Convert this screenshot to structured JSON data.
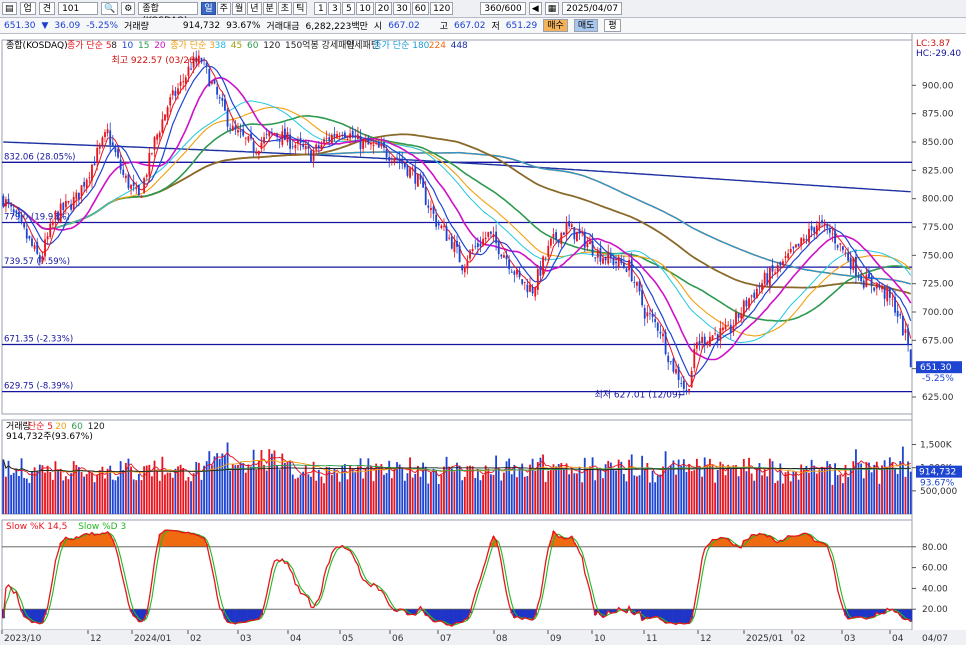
{
  "toolbar": {
    "up_label": "업",
    "period_label": "견",
    "code_value": "101",
    "name_value": "종합(KOSDAQ)",
    "tabs": [
      "일",
      "주",
      "월",
      "년",
      "분",
      "초",
      "틱"
    ],
    "intervals": [
      "1",
      "3",
      "5",
      "10",
      "20",
      "30",
      "60",
      "120"
    ],
    "count_value": "360/600",
    "date_value": "2025/04/07"
  },
  "quote": {
    "price": "651.30",
    "arrow": "▼",
    "change": "36.09",
    "change_pct": "-5.25%",
    "volume_label": "거래량",
    "volume": "914,732",
    "volume_ratio": "93.67%",
    "amount_label": "거래대금",
    "amount": "6,282,223백만",
    "open_label": "시",
    "open": "667.02",
    "high_label": "고",
    "high": "667.02",
    "low_label": "저",
    "low": "651.29",
    "buy_label": "매수",
    "sell_label": "매도",
    "eval_label": "평"
  },
  "colors": {
    "up": "#e8141e",
    "down": "#1e45d2",
    "ma5": "#e8141e",
    "ma10": "#1e45d2",
    "ma20": "#d010c8",
    "ma_slow60": "#2e9a50",
    "ma120": "#8a6a2a",
    "ma180": "#1e9bd8",
    "ma224": "#f06a10",
    "ma448": "#1a2fa0",
    "hline": "#1414a0",
    "stoch_k": "#e8141e",
    "stoch_d": "#22b822"
  },
  "chart_data": {
    "type": "candlestick",
    "title": "종합(KOSDAQ)",
    "legend_main": [
      {
        "text": "종합(KOSDAQ)",
        "color": "#000000"
      },
      {
        "text": "종가 단순 5",
        "color": "#e8141e"
      },
      {
        "text": "8",
        "color": "#222222"
      },
      {
        "text": "10",
        "color": "#1e45d2"
      },
      {
        "text": "15",
        "color": "#2e9a50"
      },
      {
        "text": "20",
        "color": "#d010c8"
      },
      {
        "text": "종가 단순 3",
        "color": "#f0a010"
      },
      {
        "text": "38",
        "color": "#20b8e0"
      },
      {
        "text": "45",
        "color": "#a0a010"
      },
      {
        "text": "60",
        "color": "#2e9a50"
      },
      {
        "text": "120",
        "color": "#222222"
      },
      {
        "text": "150억봉 강세패턴",
        "color": "#222222"
      },
      {
        "text": "약세패턴",
        "color": "#222222"
      },
      {
        "text": "종가 단순 180",
        "color": "#1e9bd8"
      },
      {
        "text": "224",
        "color": "#f06a10"
      },
      {
        "text": "448",
        "color": "#1a2fa0"
      }
    ],
    "corner_labels": [
      "LC:3.87",
      "HC:-29.40"
    ],
    "y_axis": {
      "min": 610,
      "max": 940,
      "ticks": [
        625,
        650,
        675,
        700,
        725,
        750,
        775,
        800,
        825,
        850,
        875,
        900
      ]
    },
    "x_axis": {
      "labels": [
        "2023/10",
        "12",
        "2024/01",
        "02",
        "03",
        "04",
        "05",
        "06",
        "07",
        "08",
        "09",
        "10",
        "11",
        "12",
        "2025/01",
        "02",
        "03",
        "04",
        "04/07"
      ]
    },
    "horizontal_levels": [
      {
        "value": 832.06,
        "label": "832.06 (28.05%)"
      },
      {
        "value": 779.0,
        "label": "779.0 (19.93%)"
      },
      {
        "value": 739.57,
        "label": "739.57 (7.59%)"
      },
      {
        "value": 671.35,
        "label": "671.35 (-2.33%)"
      },
      {
        "value": 629.75,
        "label": "629.75 (-8.39%)"
      }
    ],
    "max_annotation": {
      "label": "최고 922.57 (03/26)",
      "value": 922.57
    },
    "min_annotation": {
      "label": "최저 627.01 (12/09)",
      "value": 627.01
    },
    "last_price": {
      "value": "651.30",
      "change_pct": "-5.25%"
    },
    "waypoints": [
      [
        0,
        800
      ],
      [
        8,
        770
      ],
      [
        14,
        745
      ],
      [
        20,
        785
      ],
      [
        28,
        800
      ],
      [
        34,
        830
      ],
      [
        40,
        858
      ],
      [
        46,
        820
      ],
      [
        52,
        800
      ],
      [
        58,
        850
      ],
      [
        63,
        882
      ],
      [
        68,
        900
      ],
      [
        72,
        918
      ],
      [
        76,
        922
      ],
      [
        82,
        890
      ],
      [
        88,
        860
      ],
      [
        96,
        845
      ],
      [
        104,
        858
      ],
      [
        112,
        848
      ],
      [
        118,
        838
      ],
      [
        124,
        852
      ],
      [
        130,
        862
      ],
      [
        136,
        850
      ],
      [
        142,
        845
      ],
      [
        150,
        838
      ],
      [
        158,
        820
      ],
      [
        166,
        780
      ],
      [
        172,
        762
      ],
      [
        176,
        742
      ],
      [
        180,
        755
      ],
      [
        186,
        768
      ],
      [
        192,
        752
      ],
      [
        198,
        728
      ],
      [
        203,
        720
      ],
      [
        210,
        760
      ],
      [
        216,
        775
      ],
      [
        222,
        765
      ],
      [
        228,
        752
      ],
      [
        234,
        745
      ],
      [
        240,
        740
      ],
      [
        246,
        700
      ],
      [
        252,
        685
      ],
      [
        256,
        655
      ],
      [
        260,
        640
      ],
      [
        262,
        628
      ],
      [
        266,
        672
      ],
      [
        272,
        680
      ],
      [
        278,
        682
      ],
      [
        286,
        712
      ],
      [
        292,
        728
      ],
      [
        298,
        740
      ],
      [
        306,
        760
      ],
      [
        312,
        778
      ],
      [
        318,
        768
      ],
      [
        324,
        748
      ],
      [
        330,
        728
      ],
      [
        336,
        722
      ],
      [
        342,
        705
      ],
      [
        346,
        678
      ],
      [
        348,
        668
      ]
    ],
    "candles_count": 349,
    "volume_panel": {
      "legend": [
        {
          "text": "거래량",
          "color": "#000000"
        },
        {
          "text": "단순 5",
          "color": "#e8141e"
        },
        {
          "text": "20",
          "color": "#f0a010"
        },
        {
          "text": "60",
          "color": "#2e9a50"
        },
        {
          "text": "120",
          "color": "#222222"
        }
      ],
      "value_label": "914,732주(93.67%)",
      "ticks": [
        {
          "value": 1500000,
          "label": "1,500K"
        },
        {
          "value": 1000000,
          "label": "1,000K"
        },
        {
          "value": 500000,
          "label": "500,000"
        }
      ],
      "last": {
        "value": "914,732",
        "ratio": "93.67%"
      },
      "max": 1900000
    },
    "stoch_panel": {
      "legend": [
        {
          "text": "Slow %K 14,5",
          "color": "#e8141e"
        },
        {
          "text": "Slow %D 3",
          "color": "#22b822"
        }
      ],
      "ticks": [
        80,
        60,
        40,
        20
      ],
      "upper": 80,
      "lower": 20
    }
  }
}
